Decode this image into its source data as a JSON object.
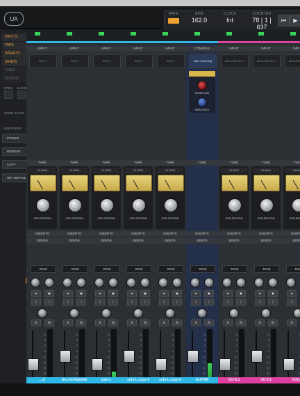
{
  "transport": {
    "rate_label": "RATE",
    "bpm_label": "BPM",
    "bpm_value": "162.0",
    "clock_label": "CLOCK",
    "clock_value": "Int",
    "counter_label": "COUNTER",
    "counter_value": "78 | 1 | 637",
    "rew_icon": "skip-back-icon",
    "play_icon": "play-icon"
  },
  "left_panel": {
    "view_items": [
      {
        "label": "INPUTS",
        "on": true
      },
      {
        "label": "TAPE",
        "on": true
      },
      {
        "label": "INSERTS",
        "on": true
      },
      {
        "label": "SENDS",
        "on": true
      },
      {
        "label": "CUES",
        "on": false
      },
      {
        "label": "OUTPUT",
        "on": false
      }
    ],
    "open_label": "OPEN",
    "close_label": "CLOSE",
    "fixed_slots": "FIXED SLOTS",
    "modifiers_label": "MODIFIERS",
    "power_label": "POWER",
    "remove_label": "REMOVE",
    "copy_label": "COPY",
    "set_default_label": "SET DEFAULT"
  },
  "section_headers": {
    "input": "INPUT",
    "console": "CONSOLE",
    "tape": "TAPE",
    "inserts": "INSERTS",
    "sends": "SENDS",
    "saturation": "SATURATION",
    "headroom": "HEADROOM",
    "impedance": "IMPEDANCE",
    "read": "Read",
    "new_summing": "New Summing",
    "mic_line": "MIC/LINE/HIZ 1"
  },
  "channels": [
    {
      "name": "...O",
      "color": "#2fb7e6",
      "db": "",
      "meter": 0.0
    },
    {
      "name": "Gtr.JimHighDbl",
      "color": "#2fb7e6",
      "db": "-7.3",
      "meter": 0.0
    },
    {
      "name": "solo L",
      "color": "#2fb7e6",
      "db": "-20.1",
      "meter": 0.22
    },
    {
      "name": "solo L.copy 4",
      "color": "#2fb7e6",
      "db": "-20.5",
      "meter": 0.0
    },
    {
      "name": "solo L.copy 6",
      "color": "#2fb7e6",
      "db": "-20.5",
      "meter": 0.0
    },
    {
      "name": "GUITAR",
      "color": "#2fb7e6",
      "db": "-14.7",
      "meter": 0.38,
      "console": true
    },
    {
      "name": "VC+0.1",
      "color": "#e040a0",
      "db": "-26.5",
      "meter": 0.0
    },
    {
      "name": "VC-0.1",
      "color": "#e040a0",
      "db": "-22.3",
      "meter": 0.0
    },
    {
      "name": "VOCAL",
      "color": "#e040a0",
      "db": "",
      "meter": 0.0
    }
  ],
  "colors": {
    "accent": "#f0a030",
    "cyan": "#2fb7e6",
    "magenta": "#e040a0",
    "meter_green": "#3bd35a"
  }
}
